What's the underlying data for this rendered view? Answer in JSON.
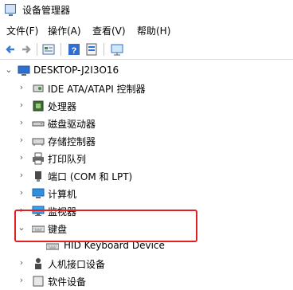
{
  "window": {
    "title": "设备管理器"
  },
  "menu": [
    {
      "label": "文件(F)"
    },
    {
      "label": "操作(A)"
    },
    {
      "label": "查看(V)"
    },
    {
      "label": "帮助(H)"
    }
  ],
  "tree": {
    "root": "DESKTOP-J2I3O16",
    "items": [
      {
        "label": "IDE ATA/ATAPI 控制器",
        "icon": "ide-controller-icon",
        "expanded": false
      },
      {
        "label": "处理器",
        "icon": "processor-icon",
        "expanded": false
      },
      {
        "label": "磁盘驱动器",
        "icon": "disk-drive-icon",
        "expanded": false
      },
      {
        "label": "存储控制器",
        "icon": "storage-controller-icon",
        "expanded": false
      },
      {
        "label": "打印队列",
        "icon": "printer-icon",
        "expanded": false
      },
      {
        "label": "端口 (COM 和 LPT)",
        "icon": "port-icon",
        "expanded": false
      },
      {
        "label": "计算机",
        "icon": "computer-icon",
        "expanded": false
      },
      {
        "label": "监视器",
        "icon": "monitor-icon",
        "expanded": false
      },
      {
        "label": "键盘",
        "icon": "keyboard-icon",
        "expanded": true,
        "children": [
          {
            "label": "HID Keyboard Device",
            "icon": "keyboard-icon"
          }
        ]
      },
      {
        "label": "人机接口设备",
        "icon": "hid-icon",
        "expanded": false
      },
      {
        "label": "软件设备",
        "icon": "software-device-icon",
        "expanded": false
      }
    ]
  },
  "colors": {
    "highlight_border": "#e02020",
    "accent": "#1e6fd0"
  }
}
